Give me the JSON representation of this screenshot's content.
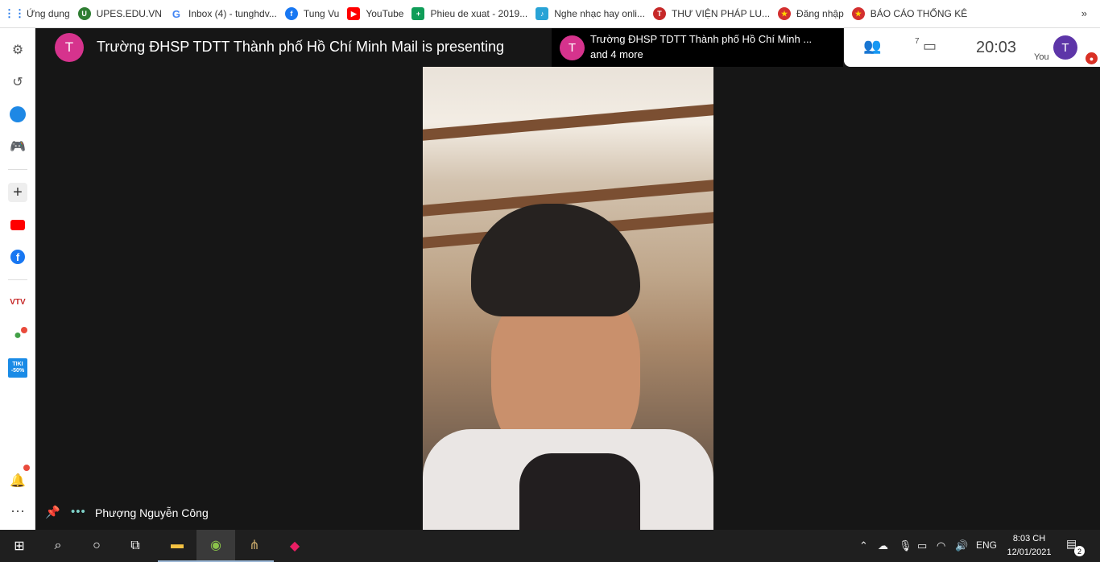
{
  "bookmarks": {
    "items": [
      {
        "label": "Ứng dụng",
        "icon": "apps-grid-icon"
      },
      {
        "label": "UPES.EDU.VN",
        "icon": "upes-icon"
      },
      {
        "label": "Inbox (4) - tunghdv...",
        "icon": "google-icon"
      },
      {
        "label": "Tung Vu",
        "icon": "facebook-icon"
      },
      {
        "label": "YouTube",
        "icon": "youtube-icon"
      },
      {
        "label": "Phieu de xuat - 2019...",
        "icon": "sheets-icon"
      },
      {
        "label": "Nghe nhạc hay onli...",
        "icon": "music-icon"
      },
      {
        "label": "THƯ VIỆN PHÁP LU...",
        "icon": "law-library-icon"
      },
      {
        "label": "Đăng nhập",
        "icon": "emblem-icon"
      },
      {
        "label": "BÁO CÁO THỐNG KÊ",
        "icon": "emblem-icon"
      }
    ],
    "overflow": "»"
  },
  "sidebar": {
    "vtv_label": "VTV",
    "tiki_label": "TIKI -50%"
  },
  "meeting": {
    "header_avatar": "T",
    "header_title": "Trường ĐHSP TDTT Thành phố Hồ Chí Minh Mail is presenting",
    "presenter_avatar": "T",
    "presenter_line1": "Trường ĐHSP TDTT Thành phố Hồ Chí Minh ...",
    "presenter_line2": "and 4 more",
    "participants_count": "7",
    "time": "20:03",
    "you_avatar": "T",
    "you_label": "You",
    "participant_name": "Phượng Nguyễn Công"
  },
  "taskbar": {
    "lang": "ENG",
    "clock_time": "8:03 CH",
    "clock_date": "12/01/2021",
    "notification_count": "2"
  },
  "colors": {
    "avatar_pink": "#d6338d",
    "you_purple": "#5d35a8",
    "stage_bg": "#161616"
  }
}
